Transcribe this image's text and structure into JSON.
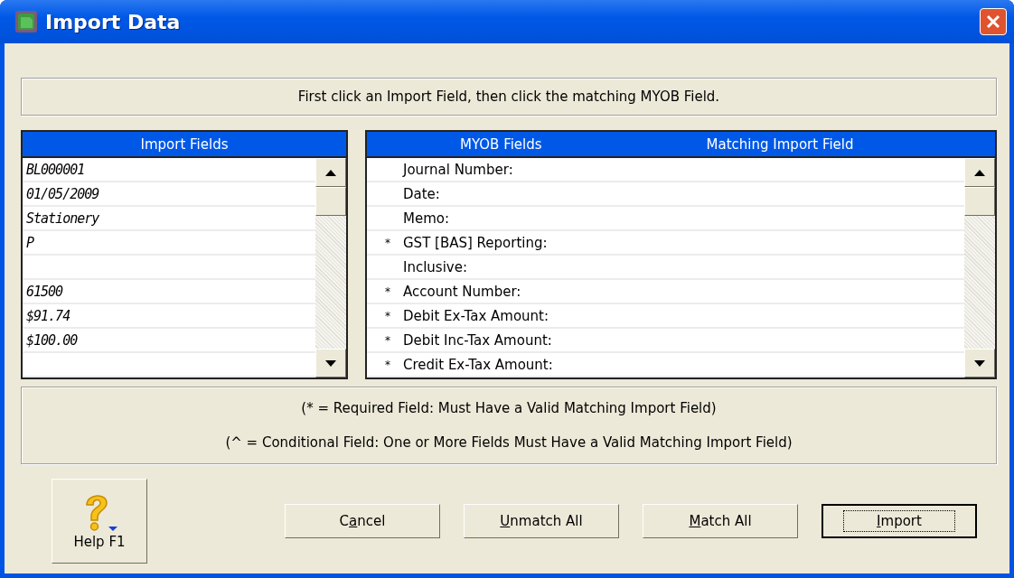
{
  "window": {
    "title": "Import Data"
  },
  "instruction": "First click an Import Field, then click the matching MYOB Field.",
  "import_fields": {
    "heading": "Import Fields",
    "rows": [
      {
        "value": "BL000001"
      },
      {
        "value": "01/05/2009"
      },
      {
        "value": "Stationery"
      },
      {
        "value": "P"
      },
      {},
      {
        "value": "61500"
      },
      {
        "value": "$91.74"
      },
      {
        "value": "$100.00"
      },
      {}
    ]
  },
  "myob_fields": {
    "columns": [
      "MYOB Fields",
      "Matching Import Field"
    ],
    "rows": [
      {
        "name": "Journal Number:"
      },
      {
        "name": "Date:"
      },
      {
        "name": "Memo:"
      },
      {
        "marker": "*",
        "name": "GST [BAS] Reporting:"
      },
      {
        "name": "Inclusive:"
      },
      {
        "marker": "*",
        "name": "Account Number:"
      },
      {
        "marker": "*",
        "name": "Debit Ex-Tax Amount:"
      },
      {
        "marker": "*",
        "name": "Debit Inc-Tax Amount:"
      },
      {
        "marker": "*",
        "name": "Credit Ex-Tax Amount:"
      }
    ]
  },
  "legend": [
    "(* = Required Field:  Must Have a Valid Matching Import Field)",
    "(^ = Conditional Field:  One or More Fields Must Have a Valid Matching Import Field)"
  ],
  "help_button": {
    "label": "Help F1"
  },
  "buttons": [
    {
      "before": "C",
      "key": "a",
      "after": "ncel",
      "default": false
    },
    {
      "key": "U",
      "after": "nmatch All",
      "default": false
    },
    {
      "key": "M",
      "after": "atch All",
      "default": false
    },
    {
      "key": "I",
      "after": "mport",
      "default": true
    }
  ]
}
